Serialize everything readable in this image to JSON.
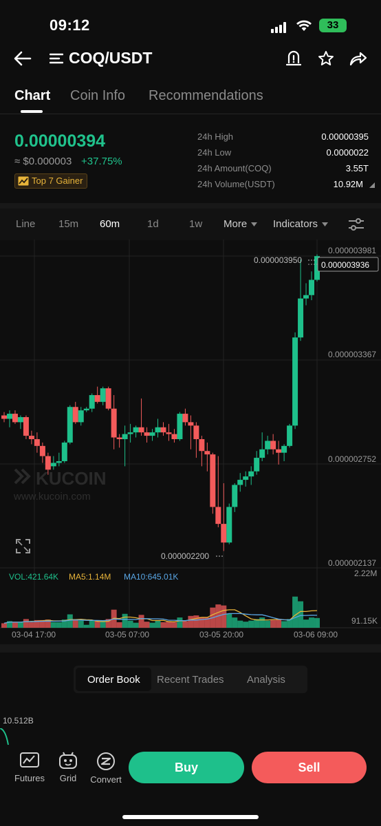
{
  "status_bar": {
    "time": "09:12",
    "battery": "33"
  },
  "header": {
    "pair": "COQ/USDT"
  },
  "tabs": [
    {
      "label": "Chart",
      "active": true
    },
    {
      "label": "Coin Info",
      "active": false
    },
    {
      "label": "Recommendations",
      "active": false
    }
  ],
  "price": {
    "last": "0.00000394",
    "fiat": "≈ $0.000003",
    "change": "+37.75%",
    "badge": "Top 7 Gainer"
  },
  "stats": [
    {
      "label": "24h High",
      "value": "0.00000395"
    },
    {
      "label": "24h Low",
      "value": "0.0000022"
    },
    {
      "label": "24h Amount(COQ)",
      "value": "3.55T"
    },
    {
      "label": "24h Volume(USDT)",
      "value": "10.92M"
    }
  ],
  "timeframes": [
    {
      "label": "Line",
      "active": false
    },
    {
      "label": "15m",
      "active": false
    },
    {
      "label": "60m",
      "active": true
    },
    {
      "label": "1d",
      "active": false
    },
    {
      "label": "1w",
      "active": false
    },
    {
      "label": "More",
      "active": false
    },
    {
      "label": "Indicators",
      "active": false
    }
  ],
  "chart": {
    "price_axis": [
      "0.000003981",
      "0.000003367",
      "0.000002752",
      "0.000002137"
    ],
    "current_price_tag": "0.000003936",
    "high_marker": "0.000003950",
    "low_marker": "0.000002200",
    "watermark": {
      "brand": "KUCOIN",
      "url": "www.kucoin.com"
    },
    "volume_axis": [
      "2.22M",
      "91.15K"
    ],
    "time_axis": [
      "03-04 17:00",
      "03-05 07:00",
      "03-05 20:00",
      "03-06 09:00"
    ],
    "legend": {
      "vol": "VOL:421.64K",
      "ma5": "MA5:1.14M",
      "ma10": "MA10:645.01K"
    },
    "colors": {
      "up": "#1ec08b",
      "down": "#f45b5b",
      "ma5": "#e8b43a",
      "ma10": "#5aa7e6"
    }
  },
  "order_tabs": [
    {
      "label": "Order Book",
      "active": true
    },
    {
      "label": "Recent Trades",
      "active": false
    },
    {
      "label": "Analysis",
      "active": false
    }
  ],
  "depth": {
    "value": "10.512B"
  },
  "bottom_nav": [
    {
      "label": "Futures"
    },
    {
      "label": "Grid"
    },
    {
      "label": "Convert"
    }
  ],
  "actions": {
    "buy": "Buy",
    "sell": "Sell"
  },
  "chart_data": {
    "type": "candlestick",
    "ylim": [
      2.137e-06,
      3.981e-06
    ],
    "y_ticks": [
      3.981e-06,
      3.367e-06,
      2.752e-06,
      2.137e-06
    ],
    "x_ticks": [
      "03-04 17:00",
      "03-05 07:00",
      "03-05 20:00",
      "03-06 09:00"
    ],
    "candles": [
      [
        3e-06,
        3.02e-06,
        2.96e-06,
        2.98e-06
      ],
      [
        2.98e-06,
        3.03e-06,
        2.93e-06,
        3.01e-06
      ],
      [
        3.01e-06,
        3.03e-06,
        2.95e-06,
        2.96e-06
      ],
      [
        2.96e-06,
        3e-06,
        2.92e-06,
        2.99e-06
      ],
      [
        2.99e-06,
        3e-06,
        2.86e-06,
        2.88e-06
      ],
      [
        2.88e-06,
        2.91e-06,
        2.83e-06,
        2.86e-06
      ],
      [
        2.86e-06,
        2.9e-06,
        2.78e-06,
        2.82e-06
      ],
      [
        2.82e-06,
        2.84e-06,
        2.72e-06,
        2.76e-06
      ],
      [
        2.76e-06,
        2.78e-06,
        2.65e-06,
        2.68e-06
      ],
      [
        2.7e-06,
        2.76e-06,
        2.68e-06,
        2.72e-06
      ],
      [
        2.72e-06,
        2.78e-06,
        2.7e-06,
        2.73e-06
      ],
      [
        2.73e-06,
        2.85e-06,
        2.72e-06,
        2.84e-06
      ],
      [
        2.84e-06,
        3.06e-06,
        2.83e-06,
        3.05e-06
      ],
      [
        3.05e-06,
        3.08e-06,
        2.95e-06,
        2.96e-06
      ],
      [
        2.96e-06,
        3.05e-06,
        2.94e-06,
        3.03e-06
      ],
      [
        3.03e-06,
        3.05e-06,
        3.02e-06,
        3.04e-06
      ],
      [
        3.04e-06,
        3.13e-06,
        3.02e-06,
        3.12e-06
      ],
      [
        3.12e-06,
        3.17e-06,
        3.07e-06,
        3.08e-06
      ],
      [
        3.08e-06,
        3.17e-06,
        3.06e-06,
        3.16e-06
      ],
      [
        3.16e-06,
        3.17e-06,
        3.03e-06,
        3.04e-06
      ],
      [
        3.04e-06,
        3.12e-06,
        2.8e-06,
        2.87e-06
      ],
      [
        2.87e-06,
        2.89e-06,
        2.81e-06,
        2.86e-06
      ],
      [
        2.86e-06,
        2.94e-06,
        2.7e-06,
        2.89e-06
      ],
      [
        2.89e-06,
        2.95e-06,
        2.84e-06,
        2.9e-06
      ],
      [
        2.9e-06,
        2.94e-06,
        2.87e-06,
        2.93e-06
      ],
      [
        2.93e-06,
        3.1e-06,
        2.88e-06,
        2.9e-06
      ],
      [
        2.9e-06,
        2.93e-06,
        2.84e-06,
        2.88e-06
      ],
      [
        2.88e-06,
        2.92e-06,
        2.85e-06,
        2.9e-06
      ],
      [
        2.9e-06,
        2.98e-06,
        2.87e-06,
        2.93e-06
      ],
      [
        2.93e-06,
        2.96e-06,
        2.88e-06,
        2.9e-06
      ],
      [
        2.9e-06,
        2.95e-06,
        2.85e-06,
        2.89e-06
      ],
      [
        2.89e-06,
        2.92e-06,
        2.84e-06,
        2.86e-06
      ],
      [
        2.86e-06,
        3.02e-06,
        2.85e-06,
        3.01e-06
      ],
      [
        3.01e-06,
        3.04e-06,
        2.94e-06,
        2.96e-06
      ],
      [
        2.96e-06,
        3e-06,
        2.8e-06,
        2.94e-06
      ],
      [
        2.94e-06,
        2.96e-06,
        2.75e-06,
        2.86e-06
      ],
      [
        2.86e-06,
        2.88e-06,
        2.7e-06,
        2.79e-06
      ],
      [
        2.79e-06,
        2.84e-06,
        2.67e-06,
        2.77e-06
      ],
      [
        2.77e-06,
        2.78e-06,
        2.42e-06,
        2.46e-06
      ],
      [
        2.46e-06,
        2.76e-06,
        2.34e-06,
        2.36e-06
      ],
      [
        2.36e-06,
        2.6e-06,
        2.2e-06,
        2.25e-06
      ],
      [
        2.25e-06,
        2.48e-06,
        2.24e-06,
        2.46e-06
      ],
      [
        2.46e-06,
        2.6e-06,
        2.43e-06,
        2.59e-06
      ],
      [
        2.59e-06,
        2.66e-06,
        2.55e-06,
        2.62e-06
      ],
      [
        2.62e-06,
        2.67e-06,
        2.58e-06,
        2.64e-06
      ],
      [
        2.64e-06,
        2.7e-06,
        2.59e-06,
        2.67e-06
      ],
      [
        2.67e-06,
        2.79e-06,
        2.65e-06,
        2.75e-06
      ],
      [
        2.75e-06,
        2.9e-06,
        2.73e-06,
        2.8e-06
      ],
      [
        2.8e-06,
        2.88e-06,
        2.77e-06,
        2.85e-06
      ],
      [
        2.85e-06,
        2.89e-06,
        2.77e-06,
        2.8e-06
      ],
      [
        2.8e-06,
        2.85e-06,
        2.71e-06,
        2.78e-06
      ],
      [
        2.78e-06,
        2.83e-06,
        2.73e-06,
        2.82e-06
      ],
      [
        2.82e-06,
        2.95e-06,
        2.81e-06,
        2.94e-06
      ],
      [
        2.94e-06,
        3.49e-06,
        2.92e-06,
        3.46e-06
      ],
      [
        3.46e-06,
        3.92e-06,
        3.44e-06,
        3.69e-06
      ],
      [
        3.69e-06,
        3.78e-06,
        3.65e-06,
        3.71e-06
      ],
      [
        3.71e-06,
        3.85e-06,
        3.68e-06,
        3.8e-06
      ],
      [
        3.8e-06,
        3.95e-06,
        3.79e-06,
        3.94e-06
      ]
    ],
    "volume_ylim": [
      0,
      2220000
    ]
  }
}
